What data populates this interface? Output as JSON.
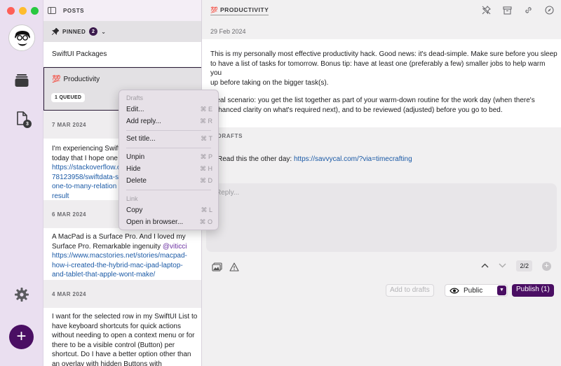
{
  "posts_header": {
    "title": "POSTS"
  },
  "pinned": {
    "label": "PINNED",
    "count": "2"
  },
  "rail": {
    "docs_badge": "3",
    "fab_label": "+"
  },
  "post_list": {
    "swift_title": "SwiftUI Packages",
    "prod_emoji": "💯",
    "prod_title": "Productivity",
    "prod_badge": "1 QUEUED",
    "date1": "7 MAR 2024",
    "post1": {
      "line1": "I'm experiencing Swift",
      "line2": "today that I hope one",
      "link1": "https://stackoverflow.c",
      "link2": "78123958/swiftdata-s",
      "link3": "one-to-many-relation",
      "link4": "result"
    },
    "date2": "6 MAR 2024",
    "post2": {
      "line1": "A MacPad is a Surface Pro. And I loved my",
      "line2a": "Surface Pro. Remarkable ingenuity ",
      "mention": "@viticci",
      "link1": "https://www.macstories.net/stories/macpad-",
      "link2": "how-i-created-the-hybrid-mac-ipad-laptop-",
      "link3": "and-tablet-that-apple-wont-make/"
    },
    "date3": "4 MAR 2024",
    "post3": {
      "line1": "I want for the selected row in my SwiftUI List to",
      "line2": "have keyboard shortcuts for quick actions",
      "line3": "without needing to open a context menu or for",
      "line4": "there to be a visible control (Button) per",
      "line5": "shortcut. Do I have a better option other than",
      "line6": "an overlay with hidden Buttons with"
    }
  },
  "main": {
    "breadcrumb_emoji": "💯",
    "breadcrumb": "PRODUCTIVITY",
    "date": "29 Feb 2024",
    "para1_l1": "This is my personally most effective productivity hack. Good news: it's dead-simple. Make sure before you sleep",
    "para1_l2": "to have a list of tasks for tomorrow. Bonus tip: have at least one (preferably a few) smaller jobs to help warm you",
    "para1_l3": "up before taking on the bigger task(s).",
    "para2_l1": "Ideal scenario: you get the list together as part of your warm-down routine for the work day (when there's",
    "para2_l2": "enhanced clarity on what's required next), and to be reviewed (adjusted) before you go to bed.",
    "drafts_label": "DRAFTS",
    "draft_text": "Read this the other day: ",
    "draft_link": "https://savvycal.com/?via=timecrafting",
    "reply_placeholder": "Reply...",
    "counter": "2/2",
    "add_to_drafts": "Add to drafts",
    "visibility": "Public",
    "publish": "Publish (1)"
  },
  "context_menu": {
    "group1": "Drafts",
    "edit": "Edit...",
    "edit_sc": "⌘ E",
    "add_reply": "Add reply...",
    "add_reply_sc": "⌘ R",
    "set_title": "Set title...",
    "set_title_sc": "⌘ T",
    "unpin": "Unpin",
    "unpin_sc": "⌘ P",
    "hide": "Hide",
    "hide_sc": "⌘ H",
    "delete": "Delete",
    "delete_sc": "⌘ D",
    "group2": "Link",
    "copy": "Copy",
    "copy_sc": "⌘ L",
    "open_browser": "Open in browser...",
    "open_browser_sc": "⌘ O"
  }
}
